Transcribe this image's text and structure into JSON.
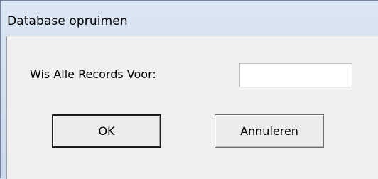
{
  "window": {
    "title": "Database opruimen"
  },
  "form": {
    "label": "Wis Alle Records Voor:",
    "input_value": ""
  },
  "buttons": {
    "ok": {
      "mnemonic": "O",
      "rest": "K"
    },
    "cancel": {
      "mnemonic": "A",
      "rest": "nnuleren"
    }
  }
}
